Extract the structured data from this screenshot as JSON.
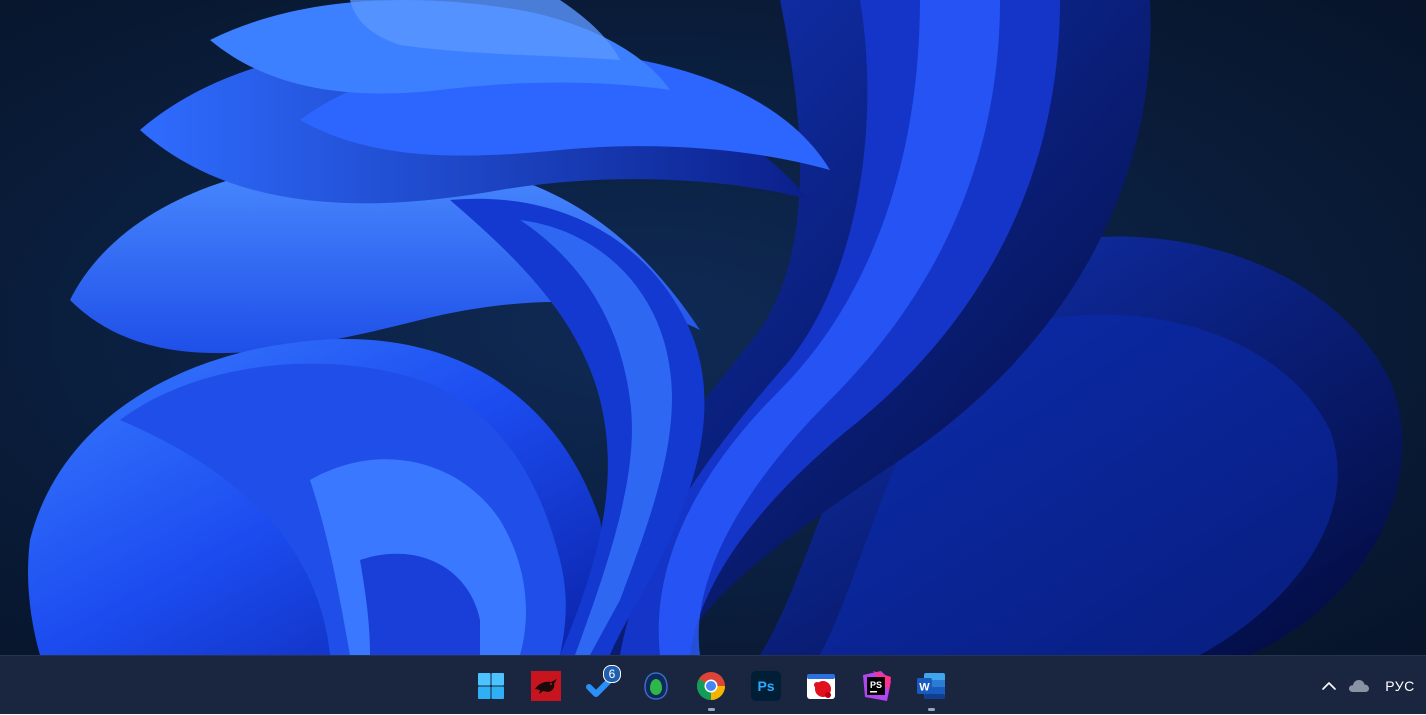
{
  "desktop": {
    "wallpaper": "windows-11-bloom-wallpaper",
    "colors": {
      "background": "#0a1a33",
      "bloom": "#1c4cf0",
      "bloom_dark": "#02104a"
    }
  },
  "taskbar": {
    "background": "#1a2640",
    "apps": [
      {
        "id": "start",
        "icon": "windows-logo-icon",
        "running": false
      },
      {
        "id": "dragon-app",
        "icon": "red-dragon-icon",
        "running": false
      },
      {
        "id": "tasks",
        "icon": "checkmark-icon",
        "running": false,
        "badge": "6"
      },
      {
        "id": "green-app",
        "icon": "green-shield-icon",
        "running": false
      },
      {
        "id": "chrome",
        "icon": "chrome-icon",
        "running": true
      },
      {
        "id": "photoshop",
        "icon": "photoshop-icon",
        "label": "Ps",
        "running": false
      },
      {
        "id": "paint-app",
        "icon": "red-paint-icon",
        "running": false
      },
      {
        "id": "phpstorm",
        "icon": "phpstorm-icon",
        "label": "PS",
        "running": false
      },
      {
        "id": "word",
        "icon": "word-icon",
        "label": "W",
        "running": true
      }
    ],
    "tray": {
      "chevron_icon": "chevron-up-icon",
      "cloud_icon": "onedrive-cloud-icon",
      "language": "РУС"
    }
  }
}
